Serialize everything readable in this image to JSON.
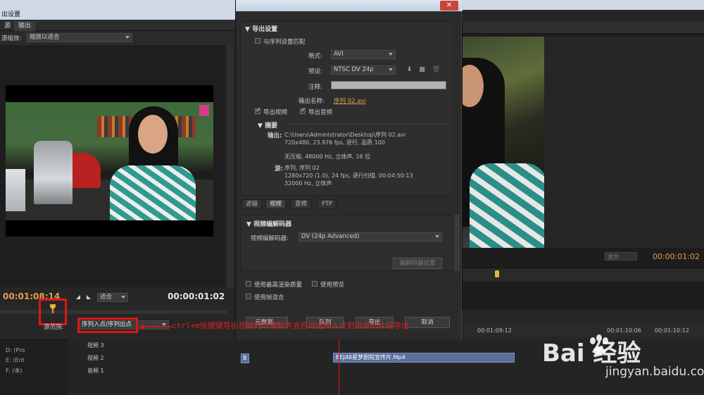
{
  "window": {
    "left_title": "出设置",
    "left_tabs": [
      "源",
      "输出"
    ]
  },
  "source": {
    "scale_label": "源缩放:",
    "scale_value": "缩放以适合",
    "timecode_in": "00:01:08:14",
    "timecode_duration": "00:00:01:02",
    "fit_value": "适合",
    "range_label": "源范围:",
    "range_value": "序列入点/序列出点"
  },
  "dialog": {
    "close_label": "✕",
    "export_settings_header": "导出设置",
    "match_sequence_label": "与序列设置匹配",
    "match_sequence_checked": false,
    "format_label": "格式:",
    "format_value": "AVI",
    "preset_label": "预设:",
    "preset_value": "NTSC DV 24p",
    "comment_label": "注释:",
    "comment_value": "",
    "output_name_label": "输出名称:",
    "output_name_value": "序列 02.avi",
    "export_video_label": "导出视频",
    "export_video_checked": true,
    "export_audio_label": "导出音频",
    "export_audio_checked": true,
    "summary_header": "摘要",
    "summary_output_label": "输出:",
    "summary_output_lines": [
      "C:\\Users\\Administrator\\Desktop\\序列 02.avi",
      "720x480, 23.976 fps, 逐行, 品质 100",
      "无压缩, 48000 Hz, 立体声, 16 位"
    ],
    "summary_source_label": "源:",
    "summary_source_lines": [
      "序列, 序列 02",
      "1280x720 (1.0), 24 fps, 逐行扫描, 00:04:50:13",
      "32000 Hz, 立体声"
    ],
    "tabs": [
      "滤镜",
      "视频",
      "音频",
      "FTP"
    ],
    "active_tab": "视频",
    "codec_header": "视频编解码器",
    "codec_label": "视频编解码器:",
    "codec_value": "DV (24p Advanced)",
    "codec_settings_button": "编解码器设置",
    "max_quality_label": "使用最高渲染质量",
    "max_quality_checked": false,
    "use_preview_label": "使用预览",
    "use_preview_checked": false,
    "frame_blend_label": "使用帧混合",
    "frame_blend_checked": false,
    "buttons": {
      "metadata": "元数据...",
      "queue": "队列",
      "export": "导出",
      "cancel": "取消"
    }
  },
  "program": {
    "zoom_value": "全分",
    "timecode": "00:00:01:02"
  },
  "timeline": {
    "ruler_labels": [
      "00:01:09:12",
      "00:01:10:06",
      "00:01:10:12"
    ],
    "tracks": [
      "视频 3",
      "视频 2",
      "音频 1"
    ],
    "clip_name": "BEJ48星梦剧院宣传片.Mp4",
    "clip_b_label": "B"
  },
  "project": {
    "drives": [
      "D: (Pro",
      "E: (Ent",
      "F: (本)"
    ]
  },
  "annotation": "ctrl+m快捷键导出视频的时候软件会自动选择入点到出点的片段导出",
  "watermark": {
    "brand": "Bai  经验",
    "url": "jingyan.baidu.com"
  },
  "colors": {
    "accent": "#e2a04a",
    "annotation": "#e01616",
    "clip": "#5b6f9c"
  }
}
